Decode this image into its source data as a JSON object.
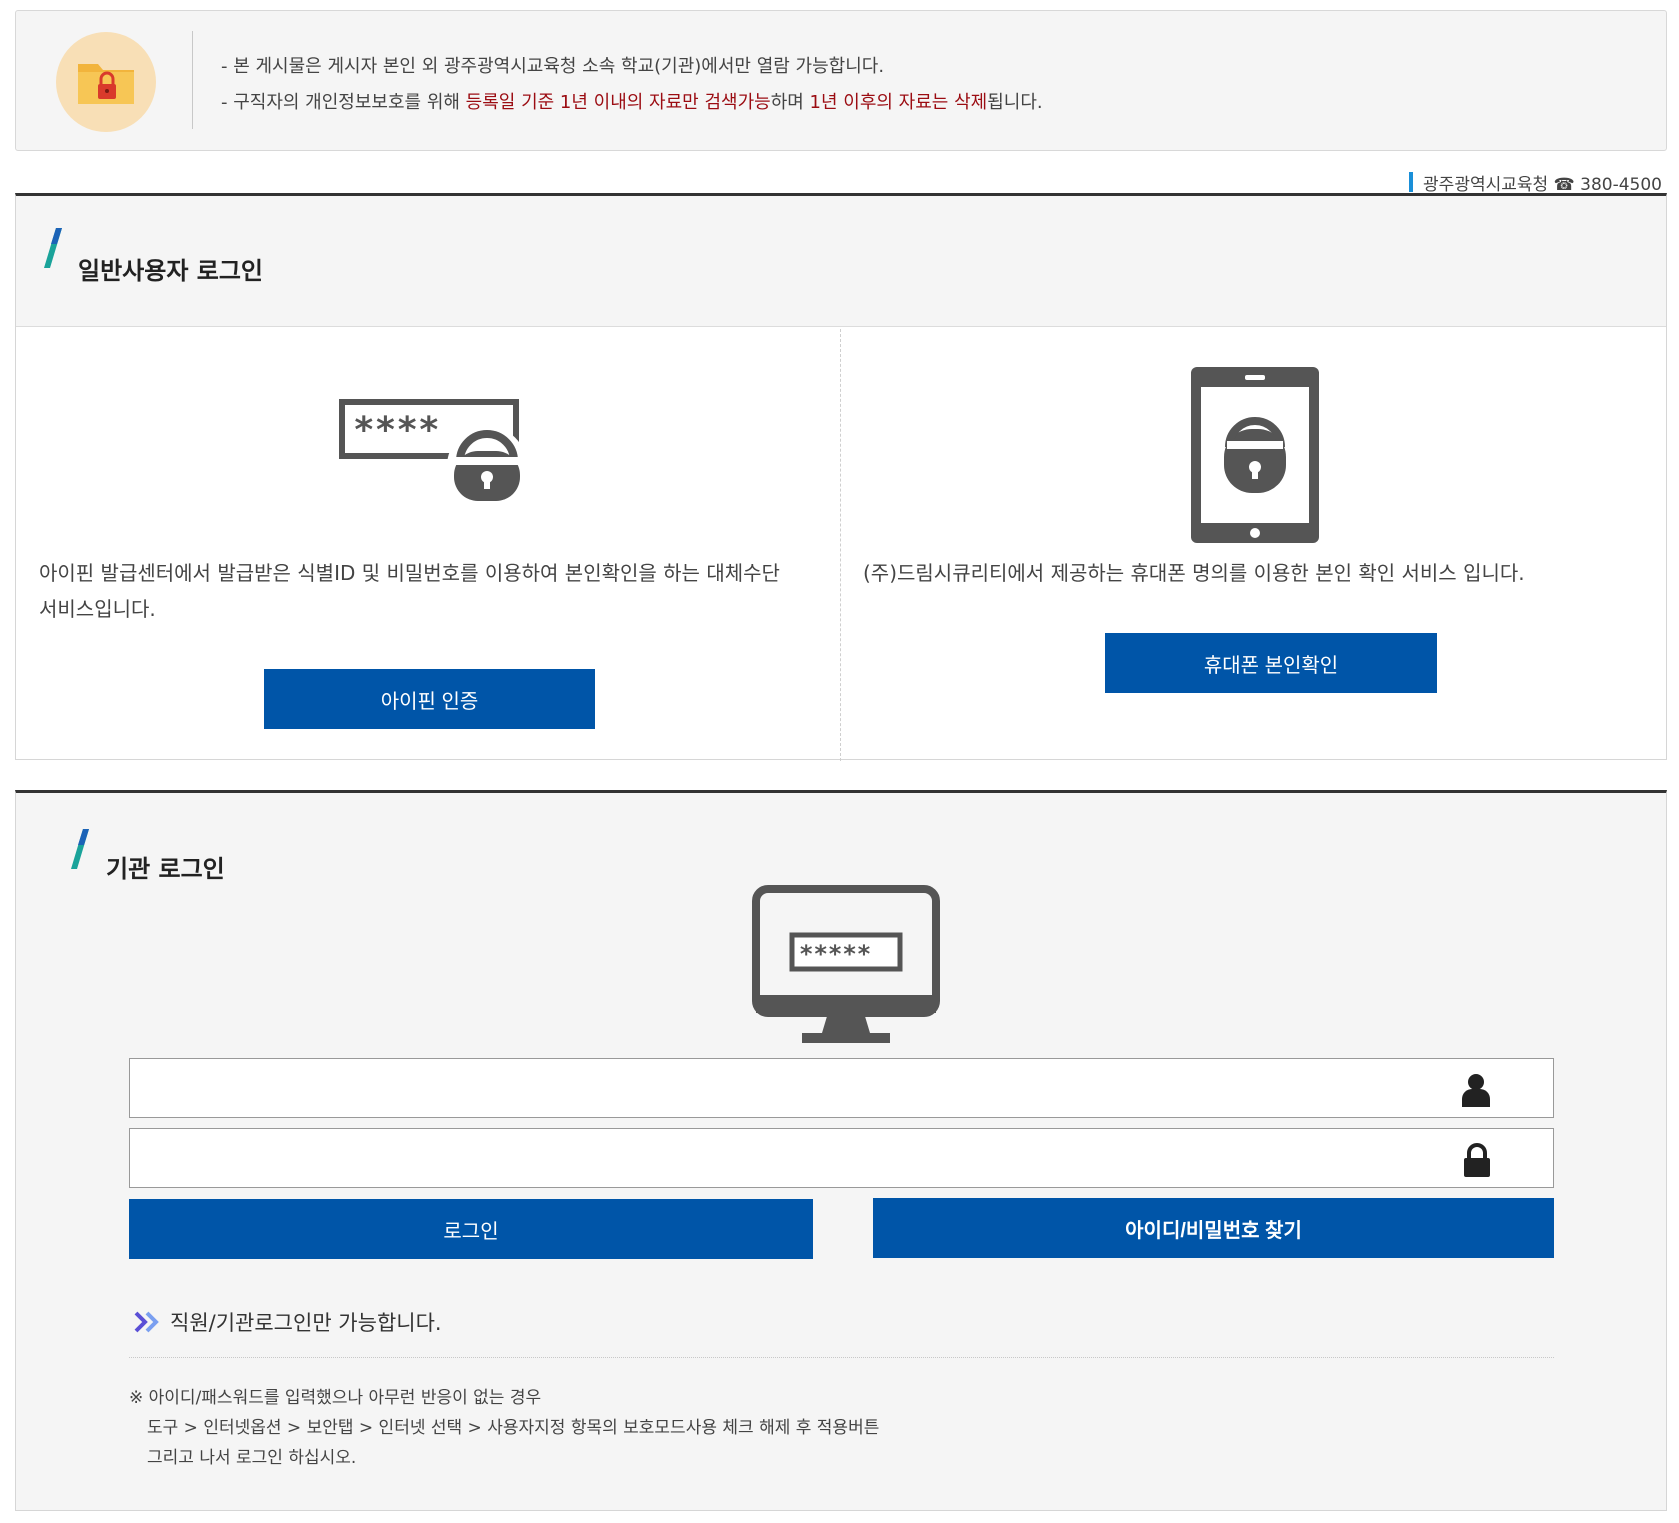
{
  "notice": {
    "line1": "- 본 게시물은 게시자 본인 외 광주광역시교육청 소속 학교(기관)에서만 열람 가능합니다.",
    "line2_a": "- 구직자의 개인정보보호를 위해 ",
    "line2_b": "등록일 기준 1년 이내의 자료만 검색가능",
    "line2_c": "하며 ",
    "line2_d": "1년 이후의 자료는 삭제",
    "line2_e": "됩니다.",
    "highlight_color": "#9b0c12"
  },
  "contact": "광주광역시교육청 ☎ 380-4500",
  "general_login": {
    "title": "일반사용자 로그인",
    "ipin": {
      "desc_line1": "아이핀 발급센터에서 발급받은 식별ID 및 비밀번호를 이용하여 본인확인을 하는 대체수단",
      "desc_line2": "서비스입니다.",
      "button": "아이핀 인증",
      "mask": "****"
    },
    "phone": {
      "desc": "(주)드림시큐리티에서 제공하는 휴대폰 명의를 이용한 본인 확인 서비스 입니다.",
      "button": "휴대폰 본인확인"
    }
  },
  "institution_login": {
    "title": "기관 로그인",
    "monitor_mask": "*****",
    "id_field": {
      "value": "",
      "placeholder": ""
    },
    "pw_field": {
      "value": "",
      "placeholder": ""
    },
    "login_button": "로그인",
    "find_button": "아이디/비밀번호 찾기",
    "note": "직원/기관로그인만 가능합니다.",
    "help_line1": "※ 아이디/패스워드를 입력했으나 아무런 반응이 없는 경우",
    "help_line2": "도구 > 인터넷옵션 > 보안탭 > 인터넷 선택 > 사용자지정 항목의 보호모드사용 체크 해제 후 적용버튼",
    "help_line3": "그리고 나서 로그인 하십시오."
  },
  "colors": {
    "primary": "#0055a8",
    "accent": "#1a8fd8",
    "icon_gray": "#555555"
  }
}
